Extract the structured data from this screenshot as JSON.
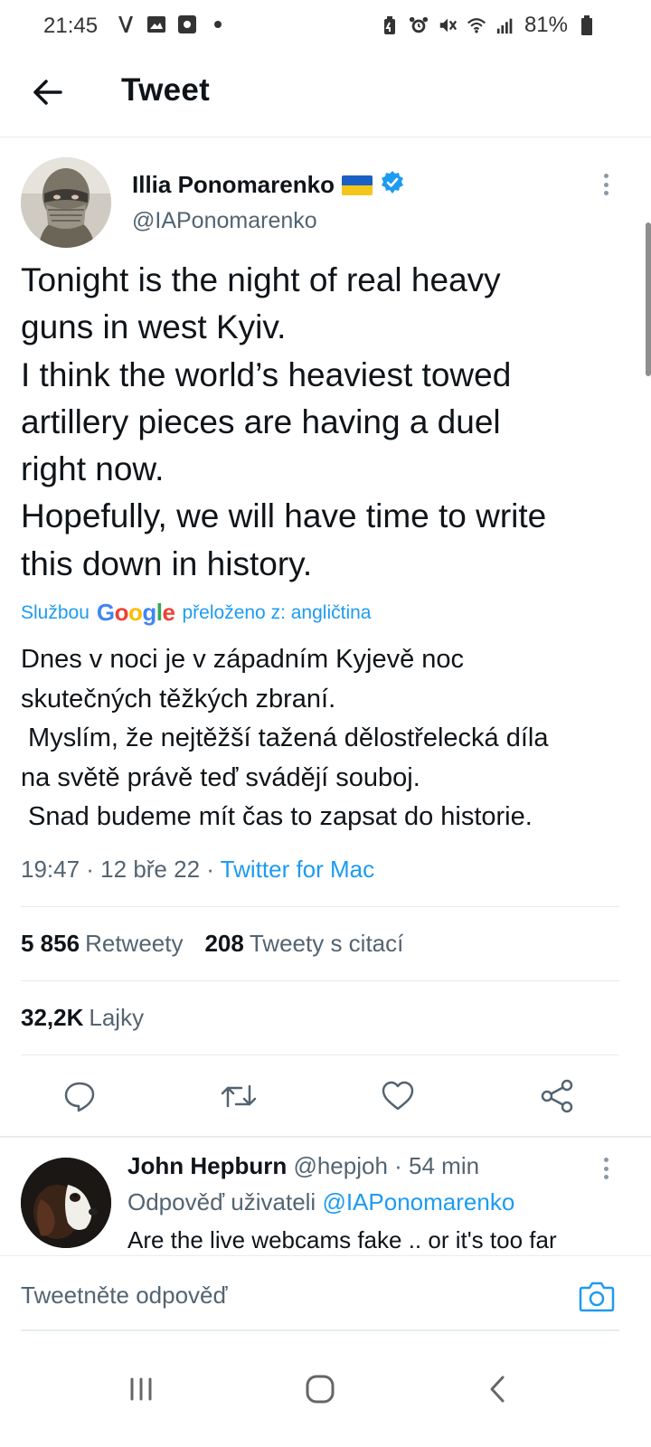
{
  "status_bar": {
    "time": "21:45",
    "battery": "81%",
    "left_icons": [
      "v-icon",
      "gallery-icon",
      "record-icon",
      "dot-icon"
    ],
    "right_icons": [
      "battery-saver-icon",
      "alarm-icon",
      "mute-icon",
      "wifi-icon",
      "signal-icon",
      "battery-icon"
    ]
  },
  "header": {
    "title": "Tweet"
  },
  "tweet": {
    "author_name": "Illia Ponomarenko",
    "handle": "@IAPonomarenko",
    "flag_colors": [
      "#1a5fc4",
      "#f5c61a"
    ],
    "verified_color": "#1d9bf0",
    "text_lines": [
      "Tonight is the night of real heavy",
      "guns in west Kyiv.",
      "I think the world’s heaviest towed",
      "artillery pieces are having a duel",
      "right now.",
      "Hopefully, we will have time to write",
      "this down in history."
    ],
    "translation": {
      "prefix": "Službou",
      "provider": "Google",
      "suffix": "přeloženo z: angličtina"
    },
    "translated_lines": [
      "Dnes v noci je v západním Kyjevě noc",
      "skutečných těžkých zbraní.",
      " Myslím, že nejtěžší tažená dělostřelecká díla",
      "na světě právě teď svádějí souboj.",
      " Snad budeme mít čas to zapsat do historie."
    ],
    "timestamp": "19:47 · 12 bře 22 · ",
    "source": "Twitter for Mac",
    "stats": {
      "retweets_count": "5 856",
      "retweets_label": "Retweety",
      "quotes_count": "208",
      "quotes_label": "Tweety s citací",
      "likes_count": "32,2K",
      "likes_label": "Lajky"
    }
  },
  "reply": {
    "name": "John Hepburn",
    "handle": "@hepjoh",
    "time": " · 54 min",
    "reply_to_label": "Odpověď uživateli ",
    "reply_to_handle": "@IAPonomarenko",
    "text": "Are the live webcams fake .. or it's too far"
  },
  "composer": {
    "placeholder": "Tweetněte odpověď"
  },
  "accent_color": "#1d9bf0"
}
